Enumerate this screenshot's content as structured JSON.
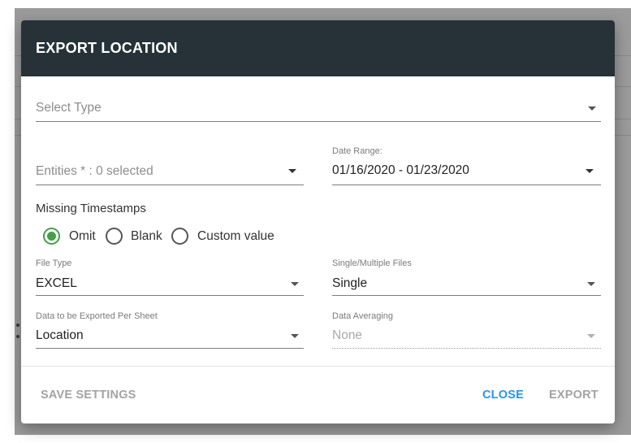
{
  "dialog": {
    "title": "EXPORT LOCATION",
    "select_type": {
      "placeholder": "Select Type"
    },
    "entities": {
      "text": "Entities * : 0 selected"
    },
    "date_range": {
      "label": "Date Range:",
      "value": "01/16/2020 - 01/23/2020"
    },
    "missing_timestamps": {
      "title": "Missing Timestamps",
      "options": [
        "Omit",
        "Blank",
        "Custom value"
      ],
      "selected": "Omit"
    },
    "file_type": {
      "label": "File Type",
      "value": "EXCEL"
    },
    "single_multiple": {
      "label": "Single/Multiple Files",
      "value": "Single"
    },
    "data_per_sheet": {
      "label": "Data to be Exported Per Sheet",
      "value": "Location"
    },
    "data_averaging": {
      "label": "Data Averaging",
      "value": "None"
    },
    "buttons": {
      "save_settings": "SAVE SETTINGS",
      "close": "CLOSE",
      "export": "EXPORT"
    }
  },
  "colors": {
    "header_bg": "#263238",
    "radio_selected": "#43a047",
    "primary_button": "#2196f3",
    "backdrop": "#9b9b9b"
  }
}
